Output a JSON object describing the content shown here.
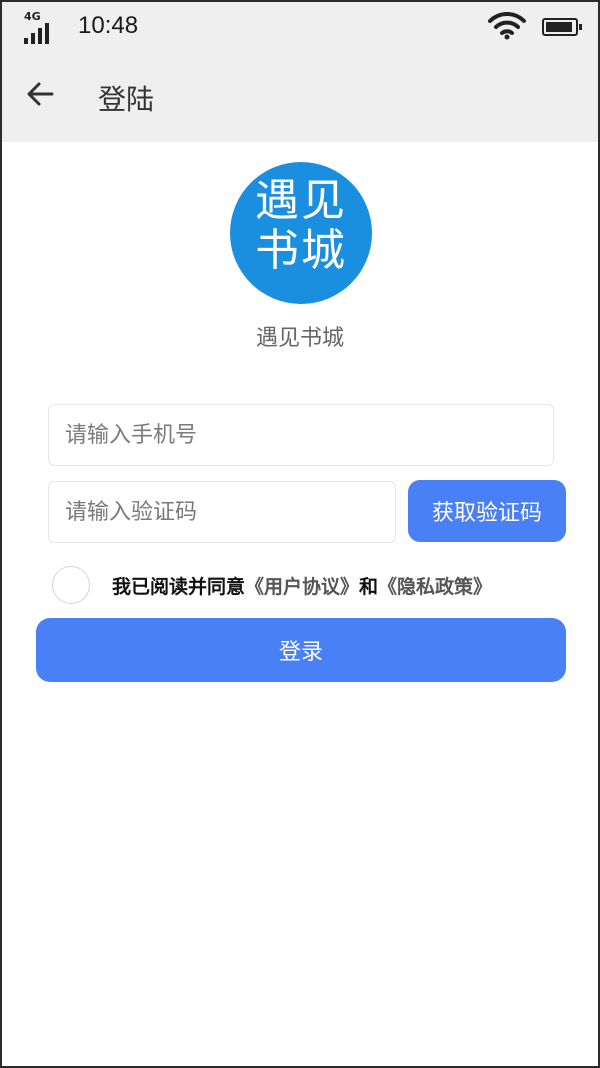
{
  "status_bar": {
    "network": "4G",
    "time": "10:48",
    "icons": [
      "signal-icon",
      "wifi-icon",
      "battery-icon"
    ]
  },
  "app_bar": {
    "title": "登陆",
    "back_icon": "arrow-left-icon"
  },
  "logo": {
    "text_line1": "遇见",
    "text_line2": "书城",
    "color": "#1a8fe0"
  },
  "app_name": "遇见书城",
  "form": {
    "phone_placeholder": "请输入手机号",
    "phone_value": "",
    "code_placeholder": "请输入验证码",
    "code_value": "",
    "get_code_label": "获取验证码",
    "agreement": {
      "checked": false,
      "prefix": "我已阅读并同意",
      "user_agreement": "《用户协议》",
      "and": "和",
      "privacy_policy": "《隐私政策》"
    },
    "login_label": "登录"
  },
  "colors": {
    "accent": "#4a80f5",
    "bar_background": "#efefef"
  }
}
